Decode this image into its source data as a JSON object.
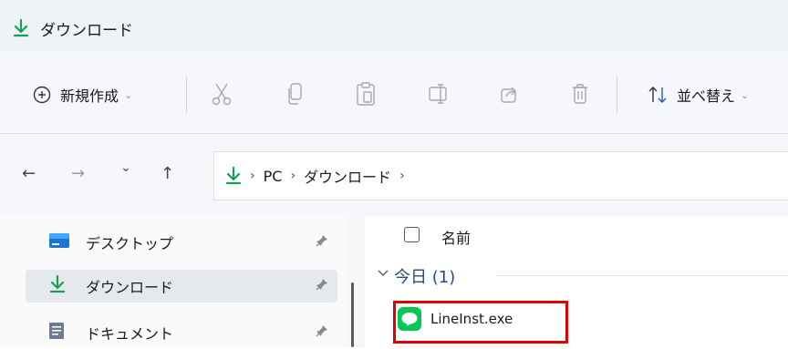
{
  "window": {
    "title": "ダウンロード"
  },
  "toolbar": {
    "new_label": "新規作成",
    "sort_label": "並べ替え",
    "icons": [
      "plus-circle-icon",
      "cut-icon",
      "copy-icon",
      "paste-icon",
      "rename-icon",
      "share-icon",
      "delete-icon",
      "sort-icon"
    ]
  },
  "address": {
    "segments": [
      "PC",
      "ダウンロード"
    ],
    "sep": "›"
  },
  "nav": {
    "back": "←",
    "forward": "→",
    "recent": "⌄",
    "up": "↑"
  },
  "sidebar": {
    "items": [
      {
        "label": "デスクトップ",
        "pinned": true
      },
      {
        "label": "ダウンロード",
        "pinned": true,
        "selected": true
      },
      {
        "label": "ドキュメント",
        "pinned": true
      }
    ],
    "pin_glyph": "📌"
  },
  "content": {
    "column_name": "名前",
    "group_label": "今日 (1)",
    "files": [
      {
        "name": "LineInst.exe",
        "icon": "line-app-icon"
      }
    ]
  },
  "colors": {
    "accent": "#1a9e56",
    "highlight": "#e00000",
    "line_green": "#06c755"
  }
}
